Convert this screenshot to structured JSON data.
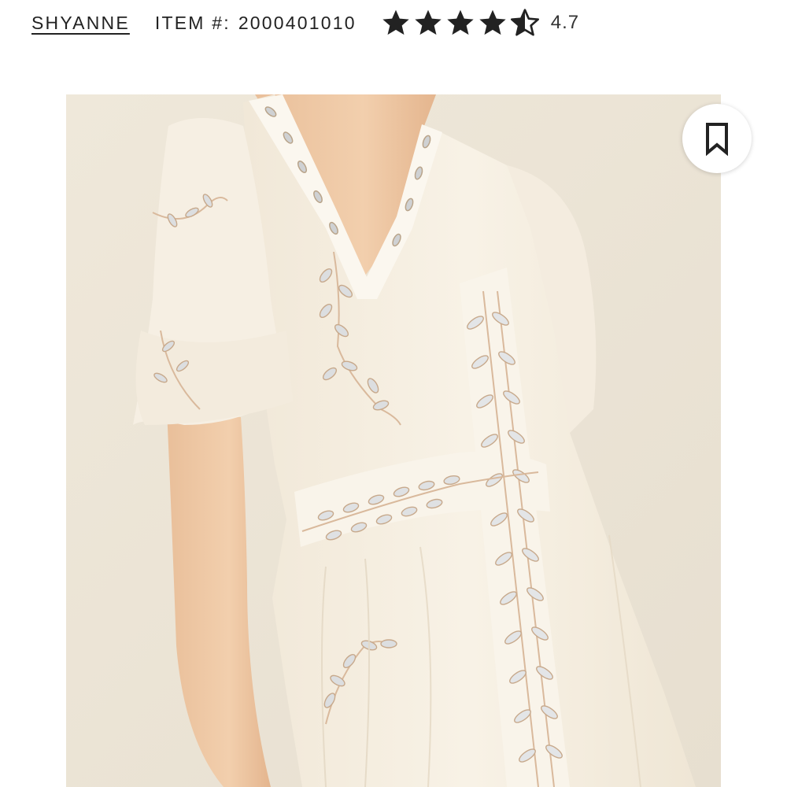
{
  "product": {
    "brand": "SHYANNE",
    "item_label": "ITEM #:",
    "item_number": "2000401010",
    "rating_value": "4.7",
    "rating_numeric": 4.7,
    "rating_max": 5
  },
  "image": {
    "alt": "White embroidered dress with mirror detailing"
  },
  "icons": {
    "bookmark": "bookmark-icon",
    "star": "star-icon"
  },
  "colors": {
    "text": "#222222",
    "star": "#222222",
    "background": "#ffffff",
    "photo_background": "#eee6d7",
    "dress": "#f6efe2"
  }
}
